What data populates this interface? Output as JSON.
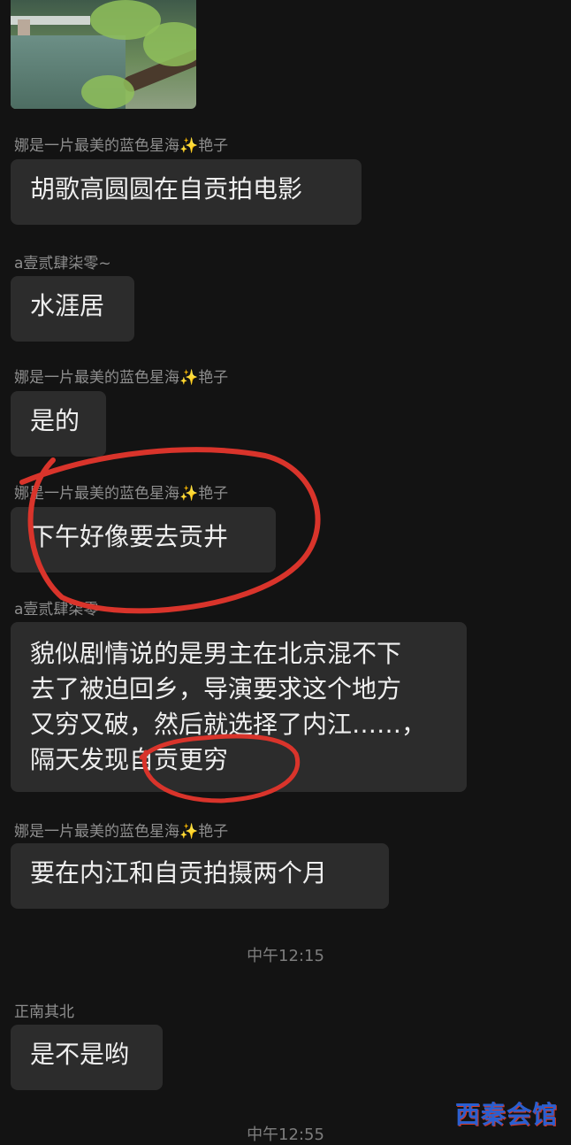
{
  "messages": [
    {
      "sender": "娜是一片最美的蓝色星海",
      "sparkle": "✨",
      "sender_suffix": "艳子",
      "text": "胡歌高圆圆在自贡拍电影"
    },
    {
      "sender": "a壹贰肆柒零~",
      "text": "水涯居"
    },
    {
      "sender": "娜是一片最美的蓝色星海",
      "sparkle": "✨",
      "sender_suffix": "艳子",
      "text": "是的"
    },
    {
      "sender": "娜是一片最美的蓝色星海",
      "sparkle": "✨",
      "sender_suffix": "艳子",
      "text": "下午好像要去贡井"
    },
    {
      "sender": "a壹贰肆柒零~",
      "lines": [
        "貌似剧情说的是男主在北京混不下",
        "去了被迫回乡，导演要求这个地方",
        "又穷又破，然后就选择了内江……，",
        "隔天发现自贡更穷"
      ]
    },
    {
      "sender": "娜是一片最美的蓝色星海",
      "sparkle": "✨",
      "sender_suffix": "艳子",
      "text": "要在内江和自贡拍摄两个月"
    },
    {
      "sender": "正南其北",
      "text": "是不是哟"
    }
  ],
  "timestamps": [
    "中午12:15",
    "中午12:55"
  ],
  "watermark": "西秦会馆",
  "colors": {
    "background": "#131313",
    "bubble": "#2c2c2c",
    "sender": "#8e8e8e",
    "annotation": "#d9342b",
    "watermark": "#2a5fd0"
  }
}
